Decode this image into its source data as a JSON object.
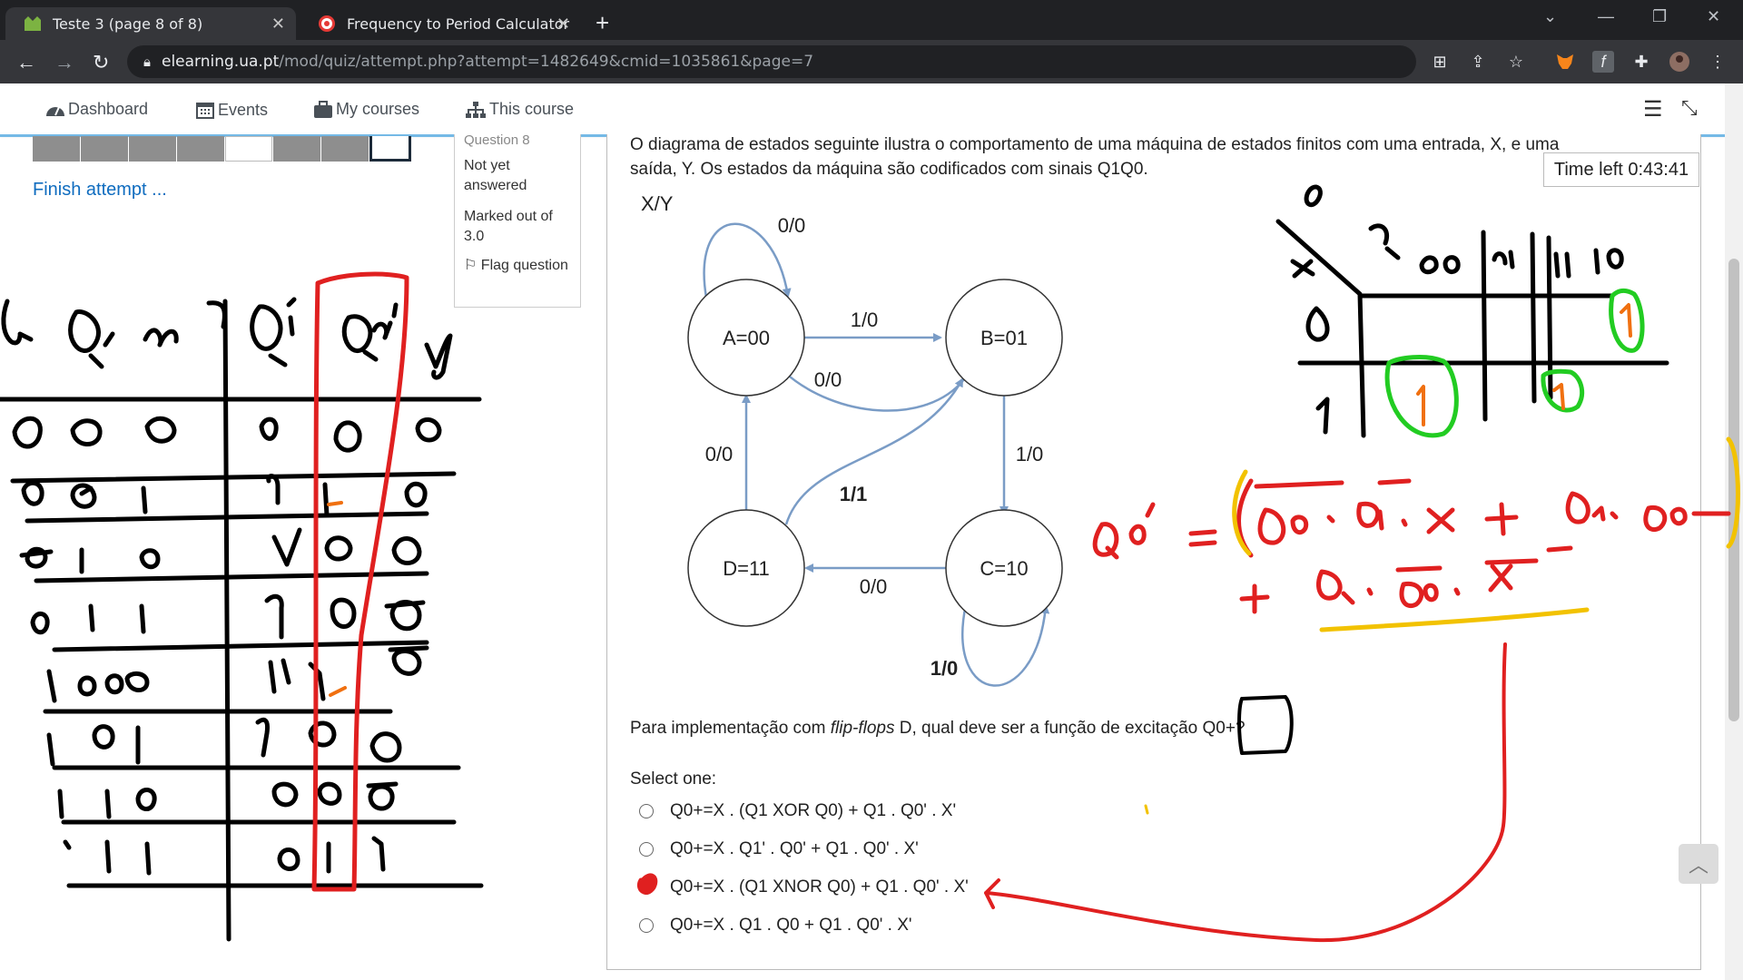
{
  "browser": {
    "tabs": [
      {
        "title": "Teste 3 (page 8 of 8)",
        "active": true
      },
      {
        "title": "Frequency to Period Calculator",
        "active": false
      }
    ],
    "url_host": "elearning.ua.pt",
    "url_path": "/mod/quiz/attempt.php?attempt=1482649&cmid=1035861&page=7"
  },
  "nav": {
    "dashboard": "Dashboard",
    "events": "Events",
    "my_courses": "My courses",
    "this_course": "This course"
  },
  "quiz_nav": {
    "finish": "Finish attempt ..."
  },
  "question_info": {
    "number_label": "Question 8",
    "status": "Not yet answered",
    "marked": "Marked out of 3.0",
    "flag": "Flag question"
  },
  "question": {
    "text_line1": "O diagrama de estados seguinte ilustra o comportamento de uma máquina de estados finitos com uma entrada, X, e uma",
    "text_line2": "saída, Y. Os estados da máquina são codificados com sinais Q1Q0.",
    "timer": "Time left 0:43:41",
    "prompt_pre": "Para implementação com ",
    "prompt_em": "flip-flops",
    "prompt_post": " D, qual deve ser a função de excitação Q0+?",
    "select_one": "Select one:",
    "options": [
      "Q0+=X . (Q1 XOR Q0) + Q1 . Q0' . X'",
      "Q0+=X . Q1' . Q0' + Q1 . Q0' . X'",
      "Q0+=X . (Q1 XNOR Q0) + Q1 . Q0' . X'",
      "Q0+=X . Q1 . Q0 + Q1 . Q0' . X'"
    ]
  },
  "diagram": {
    "legend": "X/Y",
    "states": {
      "a": "A=00",
      "b": "B=01",
      "c": "C=10",
      "d": "D=11"
    },
    "labels": {
      "a_self": "0/0",
      "a_to_b": "1/0",
      "b_to_a": "0/0",
      "b_to_c": "1/0",
      "c_to_d": "0/0",
      "c_self": "1/0",
      "d_to_a": "0/0",
      "d_to_b": "1/1"
    }
  },
  "colors": {
    "tabbar": "#202124",
    "link": "#0f6cbf",
    "arrow": "#7a9cc6",
    "ink_black": "#000000",
    "ink_red": "#e02020",
    "ink_green": "#22cc22",
    "ink_orange": "#f07010",
    "ink_yellow": "#f2c200"
  }
}
